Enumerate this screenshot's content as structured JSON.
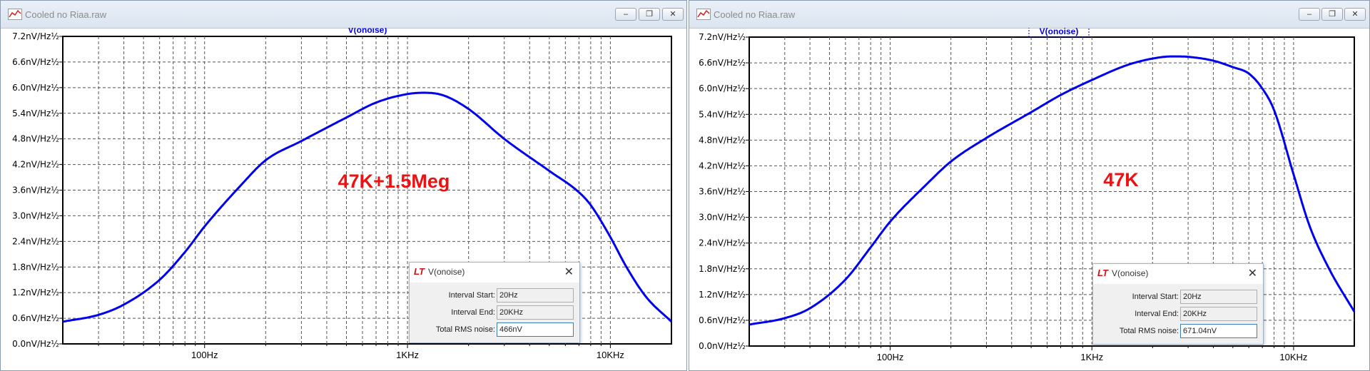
{
  "windows": [
    {
      "title": "Cooled no Riaa.raw",
      "trace_label": "V(onoise)",
      "annotation": "47K+1.5Meg",
      "dialog": {
        "logo": "LT",
        "title": "V(onoise)",
        "close": "✕",
        "rows": [
          {
            "label": "Interval Start:",
            "value": "20Hz"
          },
          {
            "label": "Interval End:",
            "value": "20KHz"
          },
          {
            "label": "Total RMS noise:",
            "value": "466nV"
          }
        ]
      }
    },
    {
      "title": "Cooled no Riaa.raw",
      "trace_label": "V(onoise)",
      "annotation": "47K",
      "dialog": {
        "logo": "LT",
        "title": "V(onoise)",
        "close": "✕",
        "rows": [
          {
            "label": "Interval Start:",
            "value": "20Hz"
          },
          {
            "label": "Interval End:",
            "value": "20KHz"
          },
          {
            "label": "Total RMS noise:",
            "value": "671.04nV"
          }
        ]
      }
    }
  ],
  "window_buttons": [
    "–",
    "❐",
    "✕"
  ],
  "chart_data": [
    {
      "type": "line",
      "xscale": "log",
      "xlim": [
        20,
        20000
      ],
      "ylim": [
        0,
        7.2
      ],
      "grid": true,
      "yticks": [
        "0.0nV/Hz½",
        "0.6nV/Hz½",
        "1.2nV/Hz½",
        "1.8nV/Hz½",
        "2.4nV/Hz½",
        "3.0nV/Hz½",
        "3.6nV/Hz½",
        "4.2nV/Hz½",
        "4.8nV/Hz½",
        "5.4nV/Hz½",
        "6.0nV/Hz½",
        "6.6nV/Hz½",
        "7.2nV/Hz½"
      ],
      "xticks": [
        {
          "x": 100,
          "label": "100Hz"
        },
        {
          "x": 1000,
          "label": "1KHz"
        },
        {
          "x": 10000,
          "label": "10KHz"
        }
      ],
      "series": [
        {
          "name": "V(onoise)",
          "color": "#0000ee",
          "x": [
            20,
            30,
            40,
            60,
            80,
            100,
            150,
            200,
            300,
            500,
            700,
            1000,
            1200,
            1500,
            2000,
            3000,
            5000,
            7000,
            8000,
            10000,
            12000,
            15000,
            20000
          ],
          "y": [
            0.52,
            0.68,
            0.92,
            1.5,
            2.15,
            2.75,
            3.7,
            4.3,
            4.75,
            5.3,
            5.65,
            5.85,
            5.88,
            5.82,
            5.5,
            4.8,
            4.05,
            3.55,
            3.25,
            2.5,
            1.8,
            1.1,
            0.52
          ]
        }
      ]
    },
    {
      "type": "line",
      "xscale": "log",
      "xlim": [
        20,
        20000
      ],
      "ylim": [
        0,
        7.2
      ],
      "grid": true,
      "yticks": [
        "0.0nV/Hz½",
        "0.6nV/Hz½",
        "1.2nV/Hz½",
        "1.8nV/Hz½",
        "2.4nV/Hz½",
        "3.0nV/Hz½",
        "3.6nV/Hz½",
        "4.2nV/Hz½",
        "4.8nV/Hz½",
        "5.4nV/Hz½",
        "6.0nV/Hz½",
        "6.6nV/Hz½",
        "7.2nV/Hz½"
      ],
      "xticks": [
        {
          "x": 100,
          "label": "100Hz"
        },
        {
          "x": 1000,
          "label": "1KHz"
        },
        {
          "x": 10000,
          "label": "10KHz"
        }
      ],
      "series": [
        {
          "name": "V(onoise)",
          "color": "#0000ee",
          "x": [
            20,
            30,
            40,
            60,
            80,
            100,
            150,
            200,
            300,
            500,
            700,
            1000,
            1500,
            2000,
            2500,
            3000,
            4000,
            5000,
            6000,
            7000,
            8000,
            10000,
            12000,
            15000,
            20000
          ],
          "y": [
            0.5,
            0.65,
            0.88,
            1.55,
            2.3,
            2.9,
            3.75,
            4.3,
            4.85,
            5.45,
            5.85,
            6.2,
            6.55,
            6.7,
            6.75,
            6.74,
            6.65,
            6.5,
            6.35,
            6.0,
            5.5,
            4.0,
            2.8,
            1.8,
            0.8
          ]
        }
      ]
    }
  ]
}
